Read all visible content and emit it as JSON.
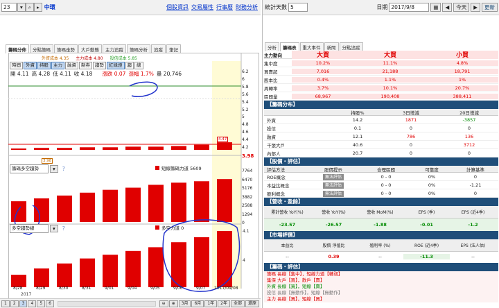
{
  "left": {
    "code": "23",
    "stock_name": "中環",
    "links": [
      "個股資訊",
      "交易屬性",
      "行事曆",
      "財務分析"
    ],
    "tabs": [
      "籌碼分佈",
      "分點籌碼",
      "籌碼走勢",
      "大戶動態",
      "主力追蹤",
      "籌碼分析",
      "追蹤",
      "筆記"
    ],
    "legend": {
      "a": "外資成本 4.35",
      "b": "主力成本 4.80",
      "c": "投信成本 5.85"
    },
    "tools": [
      "時間",
      "外資",
      "持股",
      "主力",
      "融資",
      "制券",
      "趨勢",
      "紅綠燈",
      "趨",
      "總"
    ],
    "quote": {
      "open": "開 4.11",
      "high": "高 4.28",
      "low": "低 4.11",
      "vol": "收 4.18",
      "chg": "漲跌 0.07",
      "pct": "漲幅 1.7%",
      "qty": "量 20,746"
    },
    "price_axis": [
      "6.2",
      "6",
      "5.8",
      "5.6",
      "5.4",
      "5.2",
      "5",
      "4.8",
      "4.6",
      "4.4",
      "4.2"
    ],
    "price_last": "3.98",
    "price_label_a": "3.98",
    "price_label_b": "4.47",
    "p2_title": "籌碼多空趨勢",
    "p2_legend": "短線籌碼力道 5609",
    "p2_axis": [
      "7764",
      "6470",
      "5176",
      "3882",
      "2588",
      "1294",
      "0"
    ],
    "p3_title": "多空趨勢線",
    "p3_legend": "多空力道 0",
    "p3_axis": [
      "4.1",
      "4"
    ],
    "dates": [
      "8/28",
      "8/29",
      "8/30",
      "8/31",
      "9/01",
      "9/04",
      "9/05",
      "9/06",
      "9/07",
      "2017/09/08"
    ],
    "year": "2017",
    "pages": [
      "1",
      "2",
      "3",
      "4",
      "5",
      "6"
    ],
    "zoom": [
      "3月",
      "6月",
      "1年",
      "2年",
      "全部",
      "還原"
    ]
  },
  "series": {
    "top_bars": [
      1,
      2,
      2,
      3,
      3,
      4,
      4,
      5,
      7,
      11
    ],
    "p2_bars": [
      2900,
      3300,
      3700,
      4100,
      4500,
      4800,
      5200,
      5500,
      5700,
      6000
    ],
    "p3_bars": [
      1.0,
      1.5,
      1.9,
      2.3,
      2.6,
      2.9,
      3.2,
      3.6,
      4.0,
      4.5
    ]
  },
  "right": {
    "stat_label": "統計天數",
    "stat_val": "5",
    "date_label": "日期",
    "date_val": "2017/9/8",
    "today_btn": "今天",
    "refresh": "更新",
    "tabs": [
      "分析",
      "籌碼表",
      "重大事件",
      "新聞",
      "分點追蹤"
    ],
    "top_header": [
      "主力動向",
      "大買",
      "大買",
      "小買"
    ],
    "top_rows": [
      [
        "集中度",
        "10.2%",
        "11.1%",
        "4.8%"
      ],
      [
        "買賣超",
        "7,016",
        "21,188",
        "18,791"
      ],
      [
        "股本比",
        "0.4%",
        "1.1%",
        "1%"
      ],
      [
        "周轉率",
        "3.7%",
        "10.1%",
        "20.7%"
      ],
      [
        "區間量",
        "68,967",
        "190,408",
        "388,411"
      ]
    ],
    "s1": "【籌碼分布】",
    "s1_cols": [
      "持股%",
      "3日增減",
      "20日增減"
    ],
    "s1_rows": [
      [
        "外資",
        "14.2",
        "1871",
        "-3857"
      ],
      [
        "投信",
        "0.1",
        "0",
        "0"
      ],
      [
        "融資",
        "12.1",
        "786",
        "136"
      ],
      [
        "千張大戶",
        "40.6",
        "0",
        "3712"
      ],
      [
        "內部人",
        "20.7",
        "0",
        "0"
      ]
    ],
    "s2": "【股價・評估】",
    "s2_cols": [
      "評估方法",
      "股價提示",
      "合理區間",
      "可靠度",
      "計算基準"
    ],
    "s2_rows": [
      [
        "ROE概念",
        "無法評估",
        "0 - 0",
        "0%",
        "0"
      ],
      [
        "本益比概念",
        "無法評估",
        "0 - 0",
        "0%",
        "-1.21"
      ],
      [
        "股利概念",
        "無法評估",
        "0 - 0",
        "0%",
        "0"
      ]
    ],
    "s3": "【營收・盈餘】",
    "s3_cols": [
      "累計營收 YoY(%)",
      "營收 YoY(%)",
      "營收 MoM(%)",
      "EPS (季)",
      "EPS (近4季)"
    ],
    "s3_vals": [
      "-23.57",
      "-26.57",
      "-1.88",
      "-0.01",
      "-1.2"
    ],
    "s4": "【市場評價】",
    "s4_cols": [
      "本益比",
      "股價 淨值比",
      "殖利率 (%)",
      "ROE (近4季)",
      "EPS (法人估)"
    ],
    "s4_vals": [
      "--",
      "0.39",
      "--",
      "-11.3",
      "--"
    ],
    "s5": "【籌碼・評估】",
    "s5_lines": [
      "籌碼 長線【集中】，短線力道【轉弱】",
      "集保 大戶【買】，散戶【賣】",
      "外資 長線【買】，短線【賣】",
      "投信 長線【無動作】，短線【無動作】",
      "主力 長線【買】，短線【買】"
    ]
  },
  "colors": {
    "up": "#e00000",
    "down": "#008a00",
    "accent": "#1f4e79",
    "ink": "#2233cc"
  }
}
